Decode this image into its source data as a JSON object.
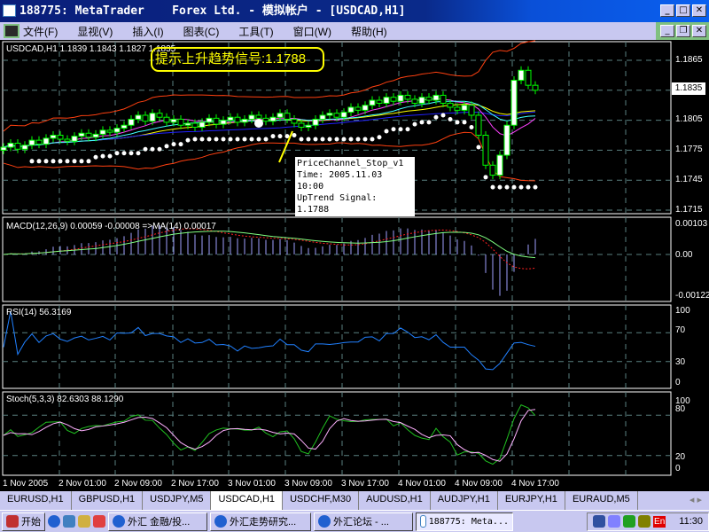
{
  "window": {
    "title": "188775: MetaTrader    Forex Ltd. - 模拟帐户 - [USDCAD,H1]"
  },
  "menu": [
    "文件(F)",
    "显视(V)",
    "插入(I)",
    "图表(C)",
    "工具(T)",
    "窗口(W)",
    "帮助(H)"
  ],
  "main": {
    "header": "USDCAD,H1  1.1839 1.1843 1.1827 1.1835",
    "signal": "提示上升趋势信号:1.1788",
    "current_price": "1.1835",
    "tooltip": [
      "PriceChannel_Stop_v1",
      "Time: 2005.11.03 10:00",
      "UpTrend Signal: 1.1788"
    ],
    "axis": [
      "1.1865",
      "1.1805",
      "1.1775",
      "1.1745",
      "1.1715"
    ]
  },
  "macd": {
    "header": "MACD(12,26,9) 0.00059 -0.00008  =>MA(14) 0.00017",
    "axis": [
      "0.00103",
      "0.00",
      "-0.00122"
    ]
  },
  "rsi": {
    "header": "RSI(14) 56.3169",
    "axis": [
      "100",
      "70",
      "30",
      "0"
    ]
  },
  "stoch": {
    "header": "Stoch(5,3,3) 82.6303 88.1290",
    "axis": [
      "100",
      "80",
      "20",
      "0"
    ]
  },
  "time_axis": [
    "1 Nov 2005",
    "2 Nov 01:00",
    "2 Nov 09:00",
    "2 Nov 17:00",
    "3 Nov 01:00",
    "3 Nov 09:00",
    "3 Nov 17:00",
    "4 Nov 01:00",
    "4 Nov 09:00",
    "4 Nov 17:00"
  ],
  "tabs": [
    "EURUSD,H1",
    "GBPUSD,H1",
    "USDJPY,M5",
    "USDCAD,H1",
    "USDCHF,M30",
    "AUDUSD,H1",
    "AUDJPY,H1",
    "EURJPY,H1",
    "EURAUD,M5"
  ],
  "active_tab": 3,
  "taskbar": {
    "start": "开始",
    "items": [
      "外汇 金融/投...",
      "外汇走势研究...",
      "外汇论坛 - ...",
      "188775: Meta..."
    ],
    "lang": "En",
    "clock": "11:30"
  },
  "chart_data": {
    "type": "candlestick",
    "symbol": "USDCAD",
    "timeframe": "H1",
    "ylim": [
      1.1705,
      1.1875
    ],
    "closes": [
      1.1778,
      1.1782,
      1.1776,
      1.178,
      1.1785,
      1.1781,
      1.1787,
      1.179,
      1.1786,
      1.1784,
      1.1789,
      1.1792,
      1.1788,
      1.1791,
      1.1795,
      1.1793,
      1.1797,
      1.18,
      1.1806,
      1.181,
      1.1804,
      1.1812,
      1.1808,
      1.1803,
      1.1806,
      1.18,
      1.1802,
      1.1798,
      1.1803,
      1.1807,
      1.1801,
      1.1805,
      1.1808,
      1.1803,
      1.1806,
      1.181,
      1.1807,
      1.1804,
      1.1808,
      1.1812,
      1.1806,
      1.1802,
      1.1798,
      1.18,
      1.1806,
      1.181,
      1.1812,
      1.1808,
      1.1813,
      1.1818,
      1.1815,
      1.182,
      1.1825,
      1.1822,
      1.1828,
      1.1824,
      1.183,
      1.1826,
      1.1822,
      1.1828,
      1.1825,
      1.183,
      1.1822,
      1.1818,
      1.1815,
      1.182,
      1.181,
      1.179,
      1.176,
      1.175,
      1.177,
      1.18,
      1.1845,
      1.1855,
      1.184,
      1.1835
    ]
  },
  "colors": {
    "bull": "#00ff00",
    "band": "#ff4010",
    "macd_hist": "#a0a0ff",
    "signal": "#ff2020",
    "rsi": "#2080ff",
    "stoch_main": "#20c020",
    "stoch_signal": "#ffb0ff"
  }
}
